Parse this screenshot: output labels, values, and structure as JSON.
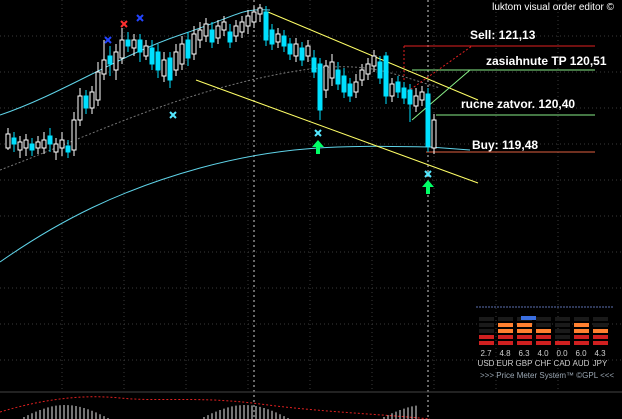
{
  "title": "luktom visual order editor ©",
  "orders": {
    "sell": "Sell: 121,13",
    "tp": "zasiahnute TP 120,51",
    "close": "rucne zatvor. 120,40",
    "buy": "Buy: 119,48"
  },
  "price_meter": {
    "values": [
      "2.7",
      "4.8",
      "6.3",
      "4.0",
      "0.0",
      "6.0",
      "4.3"
    ],
    "currencies": [
      "USD",
      "EUR",
      "GBP",
      "CHF",
      "CAD",
      "AUD",
      "JPY"
    ],
    "footer": ">>> Price Meter System™ ©GPL <<<"
  },
  "colors": {
    "background": "#000000",
    "candle_bull": "#ffffff",
    "candle_bear": "#00e0ff",
    "channel": "#ffff66",
    "ma": "#5fd3e8",
    "sell_line": "#e02020",
    "tp_line": "#88ee88",
    "close_line": "#88ee88",
    "buy_line": "#e06040",
    "arrow_up": "#00ff66",
    "cross_cyan": "#55e8ff",
    "cross_red": "#ff3030"
  }
}
